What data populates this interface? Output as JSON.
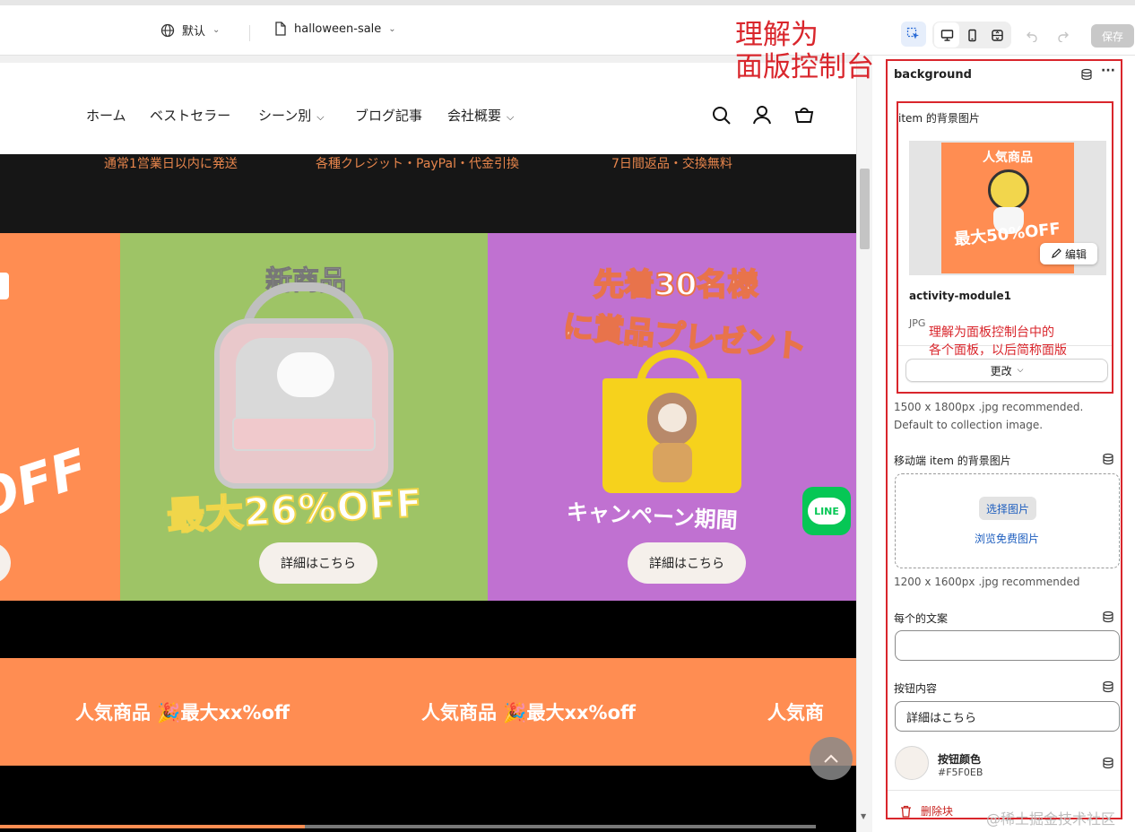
{
  "topbar": {
    "locale_label": "默认",
    "template_label": "halloween-sale",
    "save_label": "保存"
  },
  "annotations": {
    "panel_line1": "理解为",
    "panel_line2": "面版控制台",
    "sub_line1": "理解为面板控制台中的",
    "sub_line2": "各个面板，以后简称面版"
  },
  "store": {
    "nav": [
      "ホーム",
      "ベストセラー",
      "シーン別",
      "ブログ記事",
      "会社概要"
    ],
    "announcements": [
      "通常1営業日以内に発送",
      "各種クレジット・PayPal・代金引換",
      "7日間返品・交換無料"
    ],
    "panel_left_text": "OFF",
    "panel_green": {
      "title": "新商品",
      "discount": "最大26%OFF",
      "button_label": "詳細はこちら",
      "bg_color": "#9ec466"
    },
    "panel_purple": {
      "title_line1": "先着30名様",
      "title_line2": "に賞品プレゼント",
      "sub_text": "キャンペーン期間",
      "button_label": "詳細はこちら",
      "bg_color": "#c071d1"
    },
    "panel_orange_color": "#ff8d52",
    "line_badge": "LINE",
    "marquee_text": "人気商品 🎉最大xx%off",
    "marquee_cut": "人気商"
  },
  "panel": {
    "title": "background",
    "image_section": {
      "label": "item 的背景图片",
      "thumb_title": "人気商品",
      "thumb_discount": "最大50%OFF",
      "edit_label": "编辑",
      "file_name": "activity-module1",
      "file_type": "JPG",
      "change_label": "更改"
    },
    "image_hint": "1500 x 1800px .jpg recommended. Default to collection image.",
    "mobile_section": {
      "label": "移动端 item 的背景图片",
      "select_label": "选择图片",
      "browse_label": "浏览免费图片",
      "hint": "1200 x 1600px .jpg recommended"
    },
    "copy_section": {
      "label": "每个的文案",
      "value": ""
    },
    "button_text_section": {
      "label": "按钮内容",
      "value": "詳細はこちら"
    },
    "button_color_section": {
      "label": "按钮颜色",
      "hex": "#F5F0EB"
    },
    "delete_label": "删除块"
  },
  "watermark": "@稀土掘金技术社区"
}
